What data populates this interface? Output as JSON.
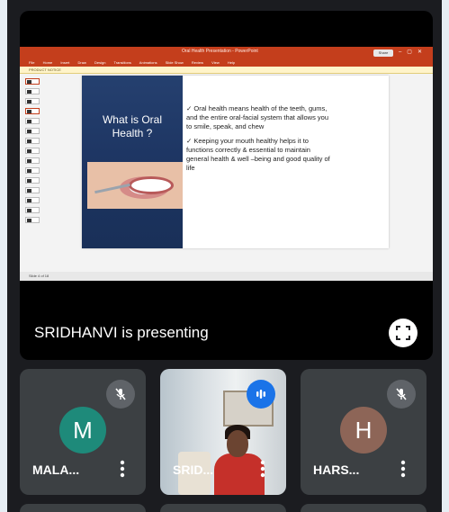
{
  "presentation": {
    "window_title": "Oral Health Presentation - PowerPoint",
    "share_label": "Share",
    "ribbon_tabs": [
      "File",
      "Home",
      "Insert",
      "Draw",
      "Design",
      "Transitions",
      "Animations",
      "Slide Show",
      "Review",
      "View",
      "Help"
    ],
    "notice_text": "PRODUCT NOTICE",
    "status_text": "Slide 4 of 18",
    "slide": {
      "heading": "What is Oral Health ?",
      "bullets": [
        "✓ Oral health means health of the teeth, gums, and the entire oral-facial system that allows you to smile, speak, and chew",
        "✓ Keeping your mouth healthy helps it to functions correctly & essential to maintain general health & well –being and good quality of life"
      ]
    }
  },
  "presenter_label": "SRIDHANVI is presenting",
  "participants": [
    {
      "initial": "M",
      "name": "MALA...",
      "avatar_color": "#1e8a7a",
      "mic": "muted",
      "icon": "mic-off-icon"
    },
    {
      "name": "SRID...",
      "mic": "speaking",
      "icon": "audio-wave-icon",
      "video": true
    },
    {
      "initial": "H",
      "name": "HARS...",
      "avatar_color": "#8d6557",
      "mic": "muted",
      "icon": "mic-off-icon"
    }
  ],
  "colors": {
    "background": "#1b1c20",
    "tile": "#3c4043",
    "speaking": "#1a73e8",
    "ppt_accent": "#c43e1c"
  }
}
